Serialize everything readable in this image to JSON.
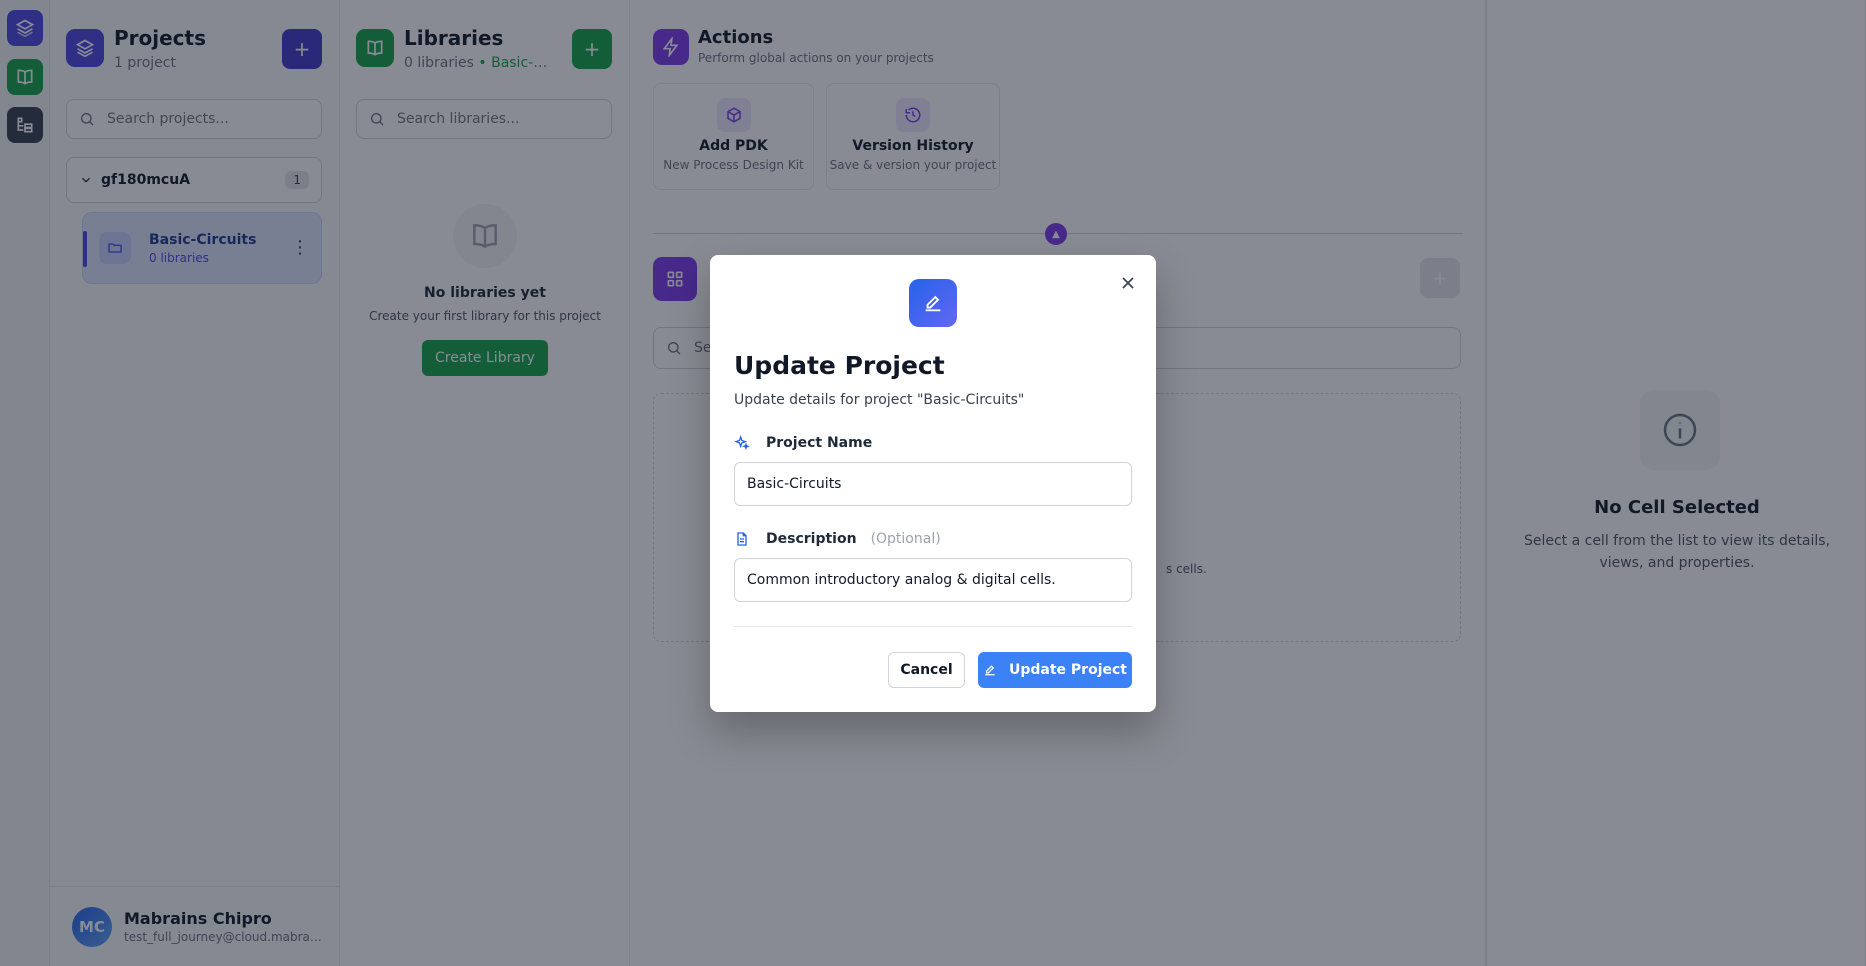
{
  "rail": {
    "items": [
      {
        "icon": "layers-icon",
        "color": "#4f46e5"
      },
      {
        "icon": "book-icon",
        "color": "#16a34a"
      },
      {
        "icon": "tree-icon",
        "color": "#374151"
      }
    ]
  },
  "projects": {
    "title": "Projects",
    "subtitle": "1 project",
    "add_label": "+",
    "search_placeholder": "Search projects...",
    "group": {
      "name": "gf180mcuA",
      "count": "1"
    },
    "items": [
      {
        "name": "Basic-Circuits",
        "libraries": "0 libraries"
      }
    ]
  },
  "user": {
    "initials": "MC",
    "name": "Mabrains Chipro",
    "email": "test_full_journey@cloud.mabrains.com"
  },
  "libraries": {
    "title": "Libraries",
    "subtitle_count": "0 libraries",
    "subtitle_project": "• Basic-Circuits",
    "add_label": "+",
    "search_placeholder": "Search libraries...",
    "empty_title": "No libraries yet",
    "empty_sub": "Create your first library for this project",
    "create_label": "Create Library"
  },
  "actions": {
    "title": "Actions",
    "subtitle": "Perform global actions on your projects",
    "cards": [
      {
        "title": "Add PDK",
        "subtitle": "New Process Design Kit"
      },
      {
        "title": "Version History",
        "subtitle": "Save & version your project"
      }
    ],
    "cells_empty_fragment": "s cells.",
    "cells_search_fragment": "Se",
    "add_label": "+"
  },
  "details": {
    "empty_title": "No Cell Selected",
    "empty_sub": "Select a cell from the list to view its details, views, and properties."
  },
  "modal": {
    "title": "Update Project",
    "subtitle": "Update details for project \"Basic-Circuits\"",
    "name_label": "Project Name",
    "name_value": "Basic-Circuits",
    "description_label": "Description",
    "description_optional": "(Optional)",
    "description_value": "Common introductory analog & digital cells.",
    "cancel_label": "Cancel",
    "submit_label": "Update Project"
  }
}
